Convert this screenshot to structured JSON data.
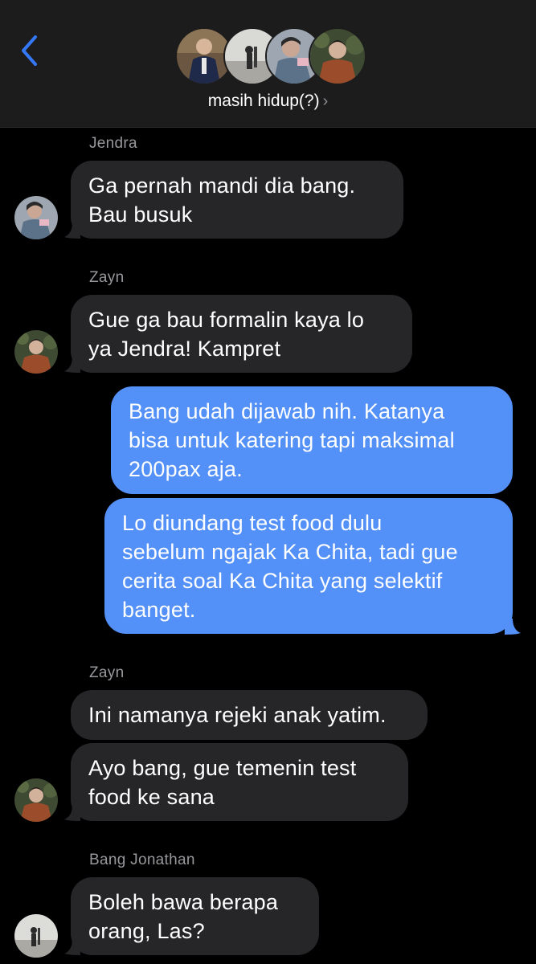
{
  "header": {
    "back_label": "",
    "group_name": "masih hidup(?)",
    "chevron": "›"
  },
  "colors": {
    "header_bg": "#1c1c1d",
    "incoming_bubble": "#262629",
    "outgoing_bubble": "#5390f7",
    "accent_blue": "#3478f6",
    "sender_label": "#98989d"
  },
  "messages": [
    {
      "sender": "Jendra",
      "lines": [
        "Ga pernah mandi dia bang.",
        "Bau busuk"
      ]
    },
    {
      "sender": "Zayn",
      "lines": [
        "Gue ga bau formalin kaya lo",
        "ya Jendra! Kampret"
      ]
    },
    {
      "sender": "",
      "lines": [
        "Bang udah dijawab nih. Katanya",
        "bisa untuk katering tapi maksimal",
        "200pax aja."
      ]
    },
    {
      "sender": "",
      "lines": [
        "Lo diundang test food dulu",
        "sebelum ngajak Ka Chita, tadi gue",
        "cerita soal Ka Chita yang selektif",
        "banget."
      ]
    },
    {
      "sender": "Zayn",
      "lines": [
        "Ini namanya rejeki anak yatim."
      ]
    },
    {
      "sender": "",
      "lines": [
        "Ayo bang, gue temenin test",
        "food ke sana"
      ]
    },
    {
      "sender": "Bang Jonathan",
      "lines": [
        "Boleh bawa berapa",
        "orang, Las?"
      ]
    }
  ]
}
